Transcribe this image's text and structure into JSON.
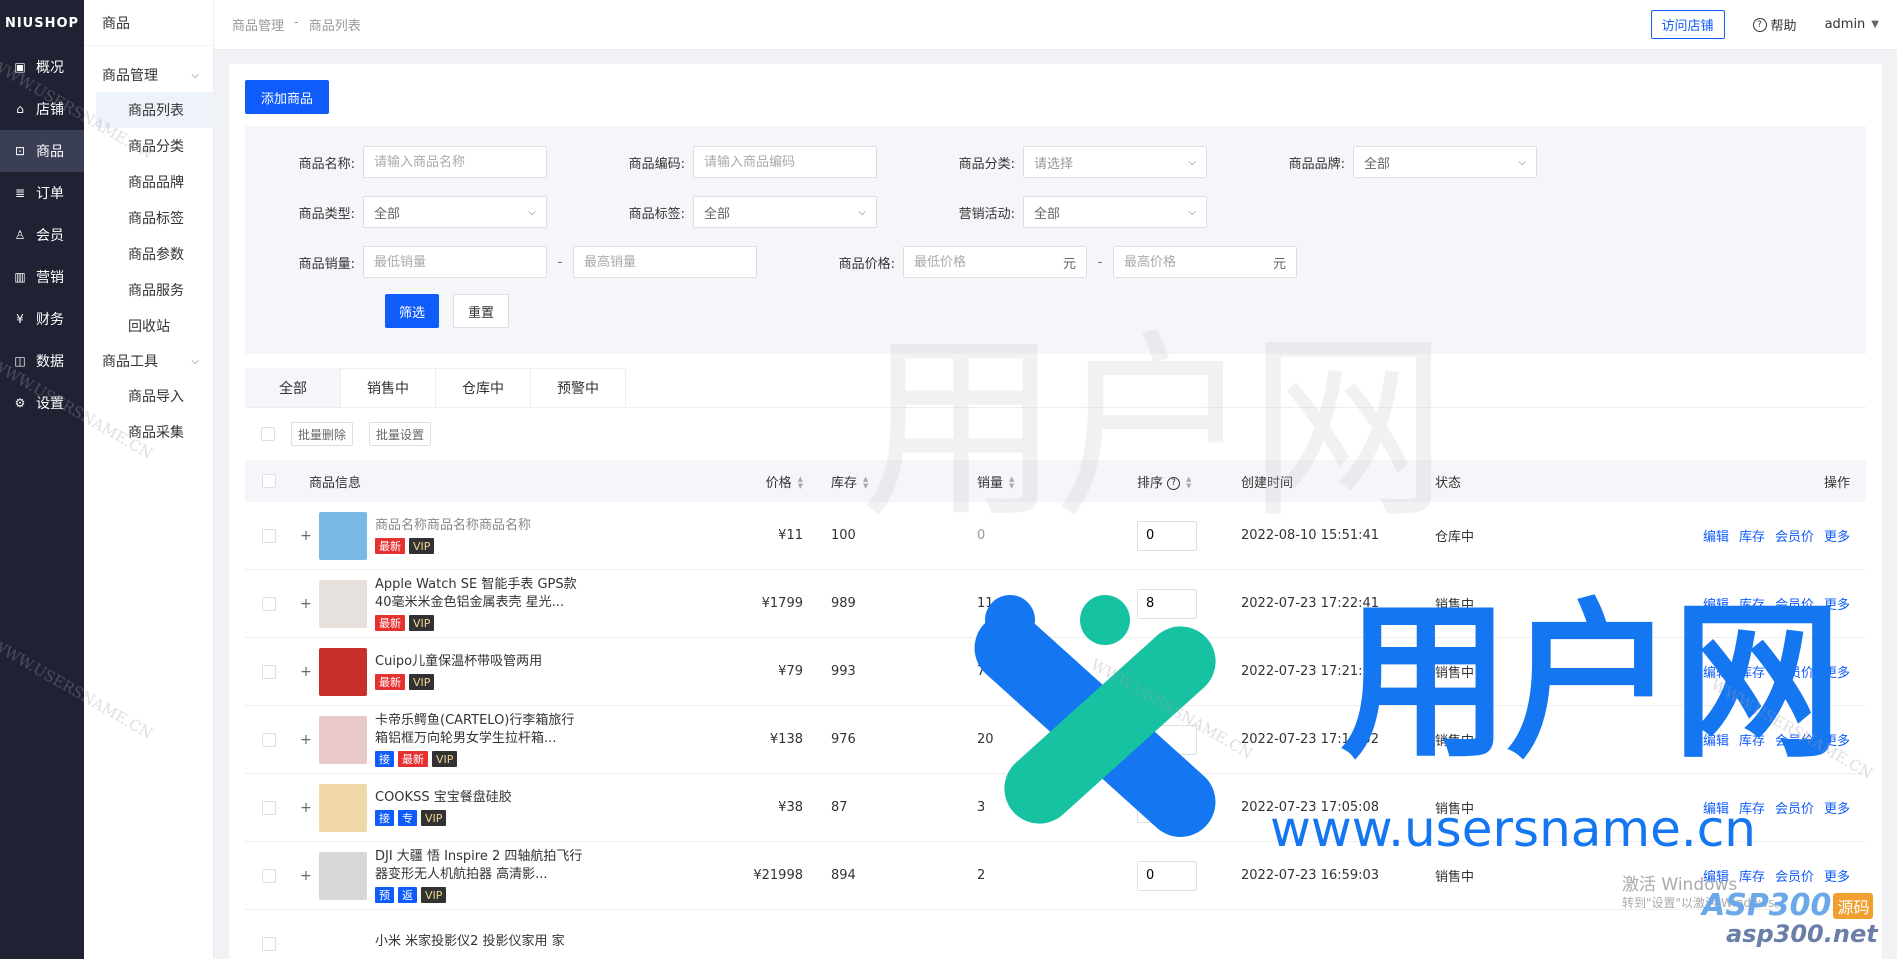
{
  "rail": {
    "logo": "NIUSHOP",
    "items": [
      {
        "label": "概况",
        "icon": "chart-board-icon"
      },
      {
        "label": "店铺",
        "icon": "store-icon"
      },
      {
        "label": "商品",
        "icon": "goods-bag-icon"
      },
      {
        "label": "订单",
        "icon": "order-list-icon"
      },
      {
        "label": "会员",
        "icon": "member-user-icon"
      },
      {
        "label": "营销",
        "icon": "bar-chart-icon"
      },
      {
        "label": "财务",
        "icon": "finance-icon"
      },
      {
        "label": "数据",
        "icon": "data-chart-icon"
      },
      {
        "label": "设置",
        "icon": "gear-icon"
      }
    ]
  },
  "side2": {
    "title": "商品",
    "groups": [
      {
        "label": "商品管理",
        "items": [
          "商品列表",
          "商品分类",
          "商品品牌",
          "商品标签",
          "商品参数",
          "商品服务",
          "回收站"
        ]
      },
      {
        "label": "商品工具",
        "items": [
          "商品导入",
          "商品采集"
        ]
      }
    ]
  },
  "header": {
    "crumb1": "商品管理",
    "sep": "-",
    "crumb2": "商品列表",
    "visit": "访问店铺",
    "help": "帮助",
    "user": "admin"
  },
  "main": {
    "add_button": "添加商品",
    "filter": {
      "name_label": "商品名称:",
      "name_placeholder": "请输入商品名称",
      "code_label": "商品编码:",
      "code_placeholder": "请输入商品编码",
      "category_label": "商品分类:",
      "category_value": "请选择",
      "brand_label": "商品品牌:",
      "brand_value": "全部",
      "type_label": "商品类型:",
      "type_value": "全部",
      "tag_label": "商品标签:",
      "tag_value": "全部",
      "promo_label": "营销活动:",
      "promo_value": "全部",
      "sales_label": "商品销量:",
      "sales_min_placeholder": "最低销量",
      "sales_max_placeholder": "最高销量",
      "price_label": "商品价格:",
      "price_min_placeholder": "最低价格",
      "price_max_placeholder": "最高价格",
      "price_unit": "元",
      "range_sep": "-",
      "submit": "筛选",
      "reset": "重置"
    },
    "tabs": [
      "全部",
      "销售中",
      "仓库中",
      "预警中"
    ],
    "batch_delete": "批量删除",
    "batch_setting": "批量设置",
    "columns": {
      "info": "商品信息",
      "price": "价格",
      "stock": "库存",
      "sales": "销量",
      "sort": "排序",
      "created": "创建时间",
      "status": "状态",
      "ops": "操作"
    },
    "ops": [
      "编辑",
      "库存",
      "会员价",
      "更多"
    ],
    "rows": [
      {
        "name": "商品名称商品名称商品名称",
        "tags": [
          [
            "最新",
            "red"
          ],
          [
            "VIP",
            "dark"
          ]
        ],
        "price": "¥11",
        "stock": "100",
        "sales": "0",
        "sort": "0",
        "created": "2022-08-10 15:51:41",
        "status": "仓库中",
        "thumb": "#7ab8e6"
      },
      {
        "name": "Apple Watch SE 智能手表 GPS款 40毫米米金色铝金属表壳 星光...",
        "tags": [
          [
            "最新",
            "red"
          ],
          [
            "VIP",
            "dark"
          ]
        ],
        "price": "¥1799",
        "stock": "989",
        "sales": "11",
        "sort": "8",
        "created": "2022-07-23 17:22:41",
        "status": "销售中",
        "thumb": "#e6e1dc"
      },
      {
        "name": "Cuipo儿童保温杯带吸管两用",
        "tags": [
          [
            "最新",
            "red"
          ],
          [
            "VIP",
            "dark"
          ]
        ],
        "price": "¥79",
        "stock": "993",
        "sales": "7",
        "sort": "0",
        "created": "2022-07-23 17:21:15",
        "status": "销售中",
        "thumb": "#c9302c"
      },
      {
        "name": "卡帝乐鳄鱼(CARTELO)行李箱旅行箱铝框万向轮男女学生拉杆箱...",
        "tags": [
          [
            "接",
            "blue"
          ],
          [
            "最新",
            "red"
          ],
          [
            "VIP",
            "dark"
          ]
        ],
        "price": "¥138",
        "stock": "976",
        "sales": "20",
        "sort": "0",
        "created": "2022-07-23 17:19:52",
        "status": "销售中",
        "thumb": "#e8c8c8"
      },
      {
        "name": "COOKSS 宝宝餐盘硅胶",
        "tags": [
          [
            "接",
            "blue"
          ],
          [
            "专",
            "blue"
          ],
          [
            "VIP",
            "dark"
          ]
        ],
        "price": "¥38",
        "stock": "87",
        "sales": "3",
        "sort": "0",
        "created": "2022-07-23 17:05:08",
        "status": "销售中",
        "thumb": "#f0d9a6"
      },
      {
        "name": "DJI 大疆 悟 Inspire 2 四轴航拍飞行器变形无人机航拍器 高清影...",
        "tags": [
          [
            "预",
            "blue"
          ],
          [
            "返",
            "blue"
          ],
          [
            "VIP",
            "dark"
          ]
        ],
        "price": "¥21998",
        "stock": "894",
        "sales": "2",
        "sort": "0",
        "created": "2022-07-23 16:59:03",
        "status": "销售中",
        "thumb": "#d8d8d8"
      },
      {
        "name": "小米 米家投影仪2 投影仪家用 家",
        "tags": [],
        "price": "",
        "stock": "",
        "sales": "",
        "sort": "",
        "created": "",
        "status": "",
        "thumb": "#ffffff"
      }
    ]
  },
  "watermark": {
    "brand_cn": "用户网",
    "brand_url": "www.usersname.cn",
    "small": "WWW.USERSNAME.CN",
    "asp_badge": "ASP300",
    "asp_badge2": "源码",
    "asp_url": "asp300.net",
    "win_line1": "激活 Windows",
    "win_line2": "转到\"设置\"以激活 Windows。"
  },
  "colors": {
    "primary": "#105cfb",
    "rail": "#1f2233",
    "tag_red": "#e63131",
    "brand_blue": "#1476f0",
    "brand_teal": "#17c2a3"
  }
}
